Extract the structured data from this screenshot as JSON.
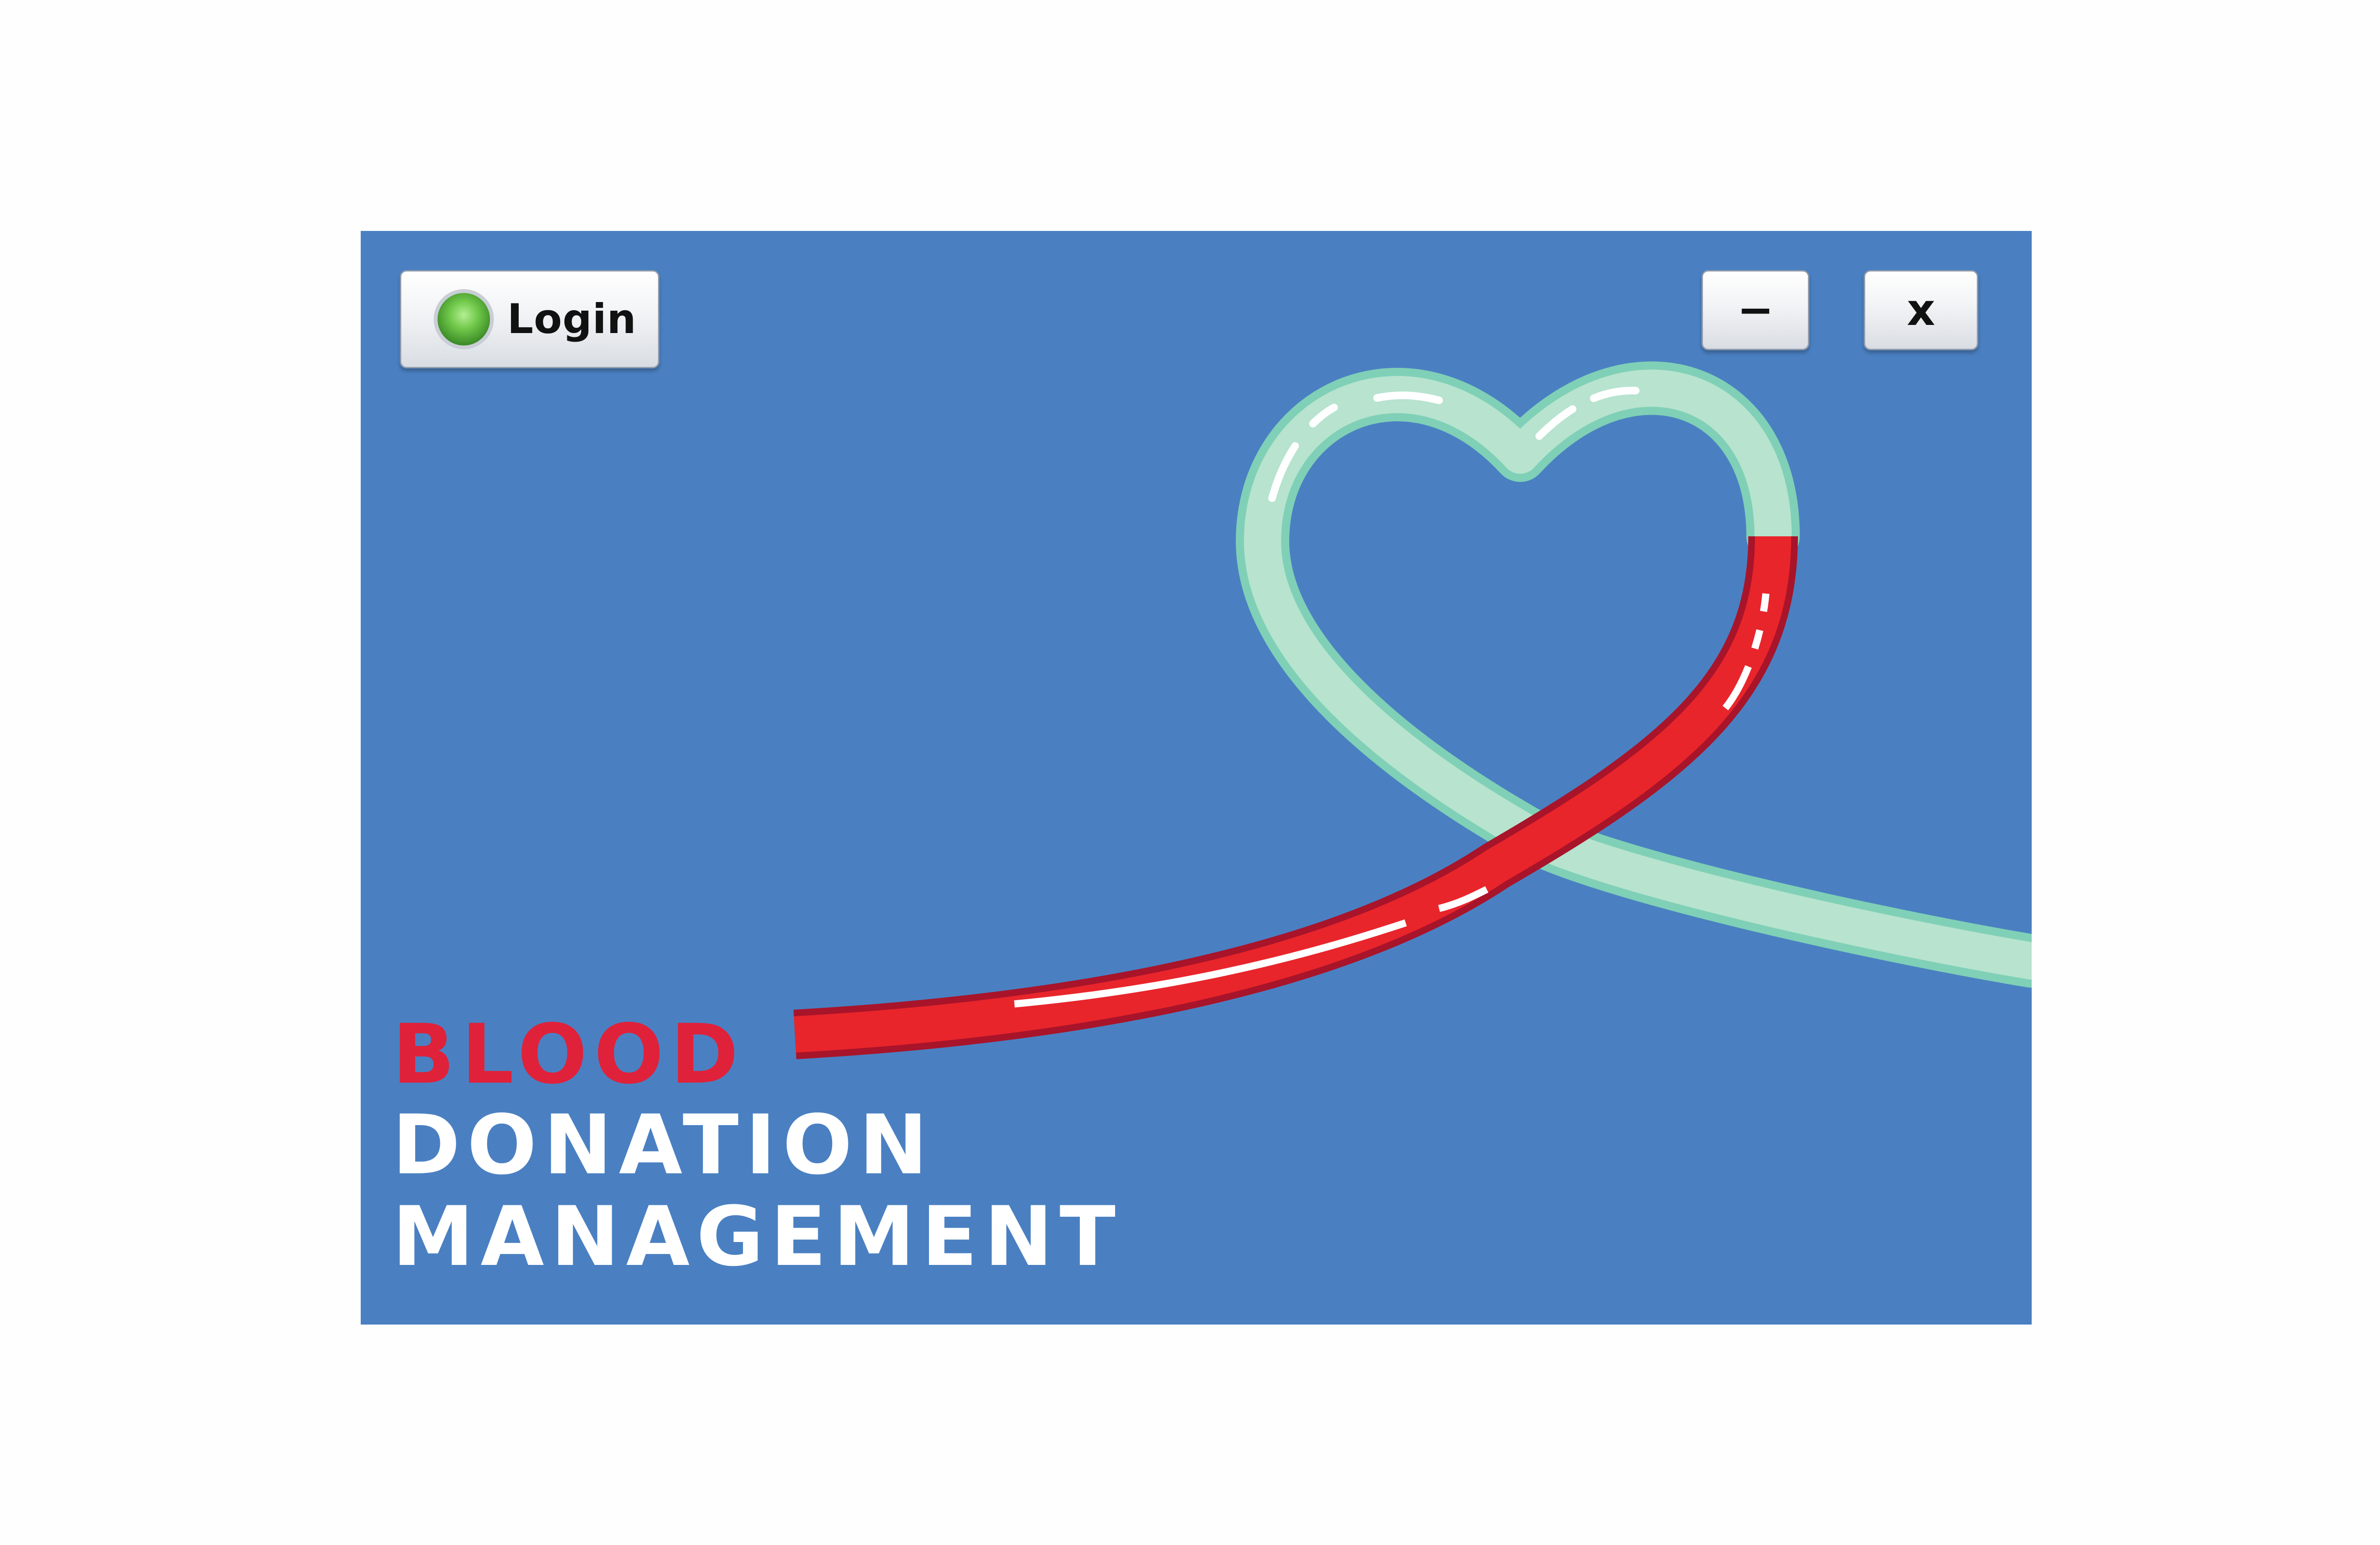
{
  "window": {
    "background": "#4a80c2"
  },
  "toolbar": {
    "login_label": "Login",
    "login_icon": "green-status-orb-icon",
    "minimize_label": "−",
    "close_label": "x"
  },
  "title": {
    "line1": "BLOOD",
    "line2": "DONATION",
    "line3": "MANAGEMENT"
  },
  "colors": {
    "blood_red": "#e0213a",
    "tube_mint": "#b7e3cf",
    "title_white": "#ffffff",
    "accent_green": "#70c84a"
  },
  "illustration": {
    "icon": "heart-shaped-blood-tube-icon"
  }
}
